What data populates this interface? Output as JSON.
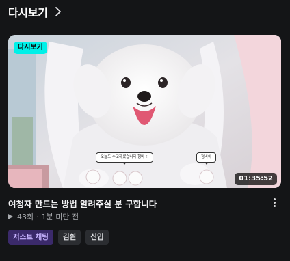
{
  "section": {
    "title": "다시보기"
  },
  "video": {
    "badge": "다시보기",
    "duration": "01:35:52",
    "title": "여청자 만드는 방법 알려주실 분 구합니다",
    "views": "43회",
    "separator": "·",
    "time_ago": "1분 미만 전",
    "bubbles": [
      "오늘도 수고하셨습니다 형바 !!",
      "형바아"
    ],
    "tags": [
      {
        "label": "저스트 채팅",
        "kind": "category"
      },
      {
        "label": "김휜",
        "kind": "tag"
      },
      {
        "label": "신입",
        "kind": "tag"
      }
    ]
  },
  "colors": {
    "background": "#141517",
    "badge_accent": "#00f0e8",
    "category_tag_bg": "#3b2a6b",
    "category_tag_text": "#c7b3ff"
  },
  "icons": {
    "chevron": "chevron-right-icon",
    "more": "more-vertical-icon",
    "play": "play-icon"
  }
}
